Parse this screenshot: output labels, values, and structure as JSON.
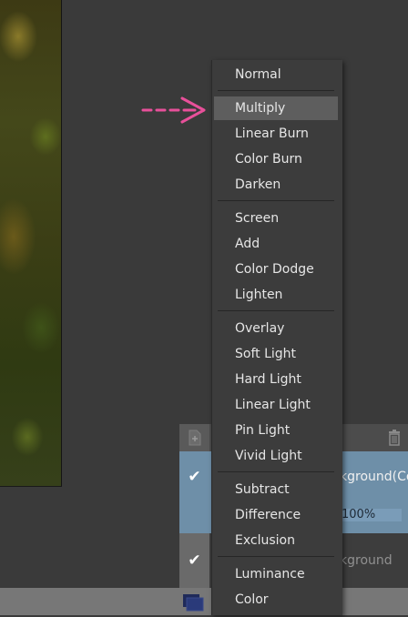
{
  "menu": {
    "groups": [
      [
        {
          "label": "Normal"
        }
      ],
      [
        {
          "label": "Multiply"
        },
        {
          "label": "Linear Burn"
        },
        {
          "label": "Color Burn"
        },
        {
          "label": "Darken"
        }
      ],
      [
        {
          "label": "Screen"
        },
        {
          "label": "Add"
        },
        {
          "label": "Color Dodge"
        },
        {
          "label": "Lighten"
        }
      ],
      [
        {
          "label": "Overlay"
        },
        {
          "label": "Soft Light"
        },
        {
          "label": "Hard Light"
        },
        {
          "label": "Linear Light"
        },
        {
          "label": "Pin Light"
        },
        {
          "label": "Vivid Light"
        }
      ],
      [
        {
          "label": "Subtract"
        },
        {
          "label": "Difference"
        },
        {
          "label": "Exclusion"
        }
      ],
      [
        {
          "label": "Luminance"
        },
        {
          "label": "Color"
        }
      ]
    ],
    "highlighted": "Multiply"
  },
  "layers": {
    "active": {
      "name_fragment": "kground(Co",
      "opacity": "100%",
      "visible_mark": "✔"
    },
    "inactive": {
      "name_fragment": "kground",
      "visible_mark": "✔"
    }
  },
  "colors": {
    "arrow": "#e8509a",
    "active_layer": "#6e8fa8",
    "menu_bg": "#3c3c3c",
    "highlight": "#5e5e5e"
  },
  "icons": {
    "new_layer": "new-layer-icon",
    "delete": "trash-icon",
    "thumbnail": "layer-thumbnail-icon",
    "pointer": "arrow-icon"
  }
}
